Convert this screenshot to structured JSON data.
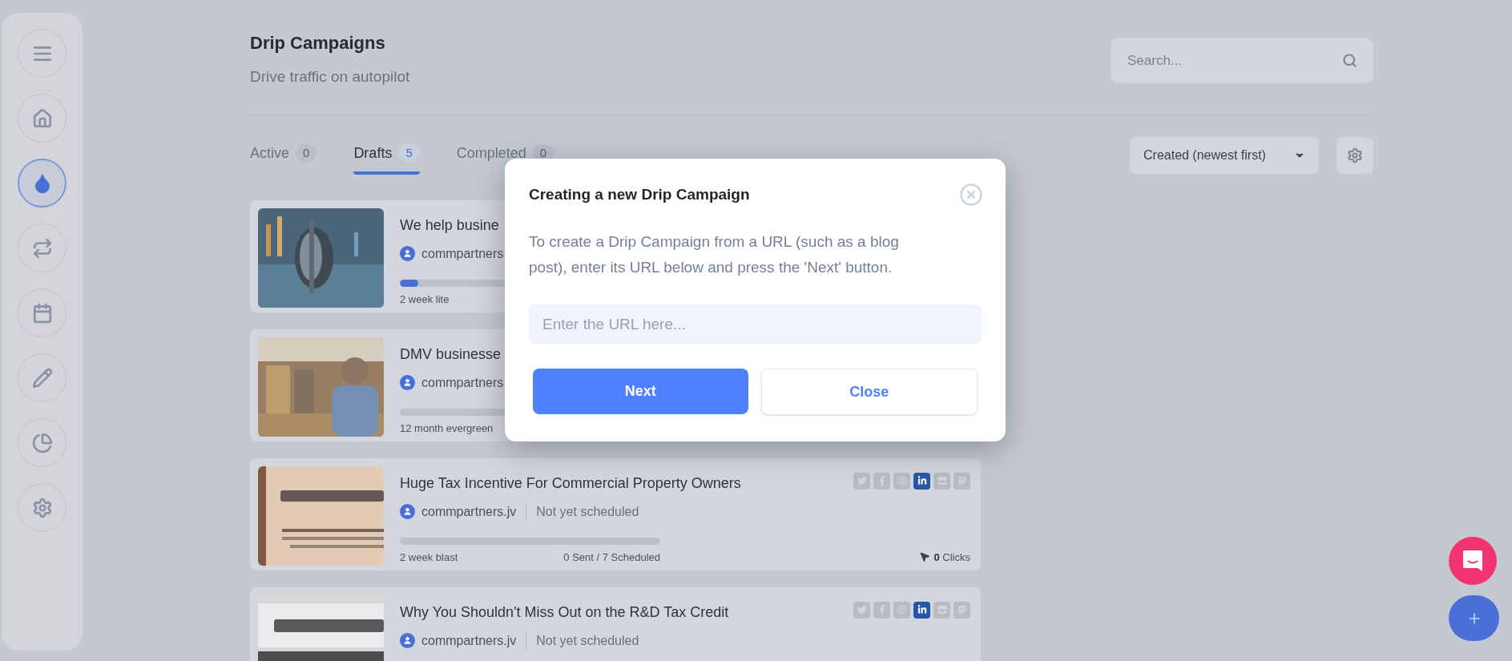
{
  "sidebar": {
    "items": [
      {
        "kind": "menu",
        "selected": false
      },
      {
        "kind": "home",
        "selected": false
      },
      {
        "kind": "drop",
        "selected": true
      },
      {
        "kind": "repeat",
        "selected": false
      },
      {
        "kind": "calendar",
        "selected": false
      },
      {
        "kind": "pencil",
        "selected": false
      },
      {
        "kind": "chart",
        "selected": false
      },
      {
        "kind": "settings",
        "selected": false
      }
    ]
  },
  "header": {
    "title": "Drip Campaigns",
    "subtitle": "Drive traffic on autopilot",
    "search": {
      "placeholder": "Search..."
    }
  },
  "tabs": [
    {
      "label": "Active",
      "count": "0",
      "selected": false
    },
    {
      "label": "Drafts",
      "count": "5",
      "selected": true
    },
    {
      "label": "Completed",
      "count": "0",
      "selected": false
    }
  ],
  "sort": {
    "value": "Created (newest first)"
  },
  "campaigns": [
    {
      "title": "We help busine",
      "account": "commpartners",
      "level": 0.07,
      "plan": "2 week lite"
    },
    {
      "title": "DMV businesse",
      "account": "commpartners",
      "plan": "12 month evergreen"
    },
    {
      "title": "Huge Tax Incentive For Commercial Property Owners",
      "account": "commpartners.jv",
      "status": "Not yet scheduled",
      "plan": "2 week blast",
      "sent": "0 Sent / 7 Scheduled",
      "clicks_count": "0",
      "clicks_label": "Clicks",
      "socials": [
        {
          "kind": "twitter",
          "on": false
        },
        {
          "kind": "facebook",
          "on": false
        },
        {
          "kind": "instagram",
          "on": false
        },
        {
          "kind": "linkedin",
          "on": true
        },
        {
          "kind": "store",
          "on": false
        },
        {
          "kind": "mastodon",
          "on": false
        }
      ]
    },
    {
      "title": "Why You Shouldn't Miss Out on the R&D Tax Credit",
      "account": "commpartners.jv",
      "status": "Not yet scheduled",
      "socials": [
        {
          "kind": "twitter",
          "on": false
        },
        {
          "kind": "facebook",
          "on": false
        },
        {
          "kind": "instagram",
          "on": false
        },
        {
          "kind": "linkedin",
          "on": true
        },
        {
          "kind": "store",
          "on": false
        },
        {
          "kind": "mastodon",
          "on": false
        }
      ]
    }
  ],
  "modal": {
    "title": "Creating a new Drip Campaign",
    "body": "To create a Drip Campaign from a URL (such as a blog post), enter its URL below and press the 'Next' button.",
    "url_field": {
      "placeholder": "Enter the URL here..."
    },
    "buttons": [
      {
        "label": "Next",
        "kind": "primary"
      },
      {
        "label": "Close",
        "kind": "secondary"
      }
    ]
  }
}
